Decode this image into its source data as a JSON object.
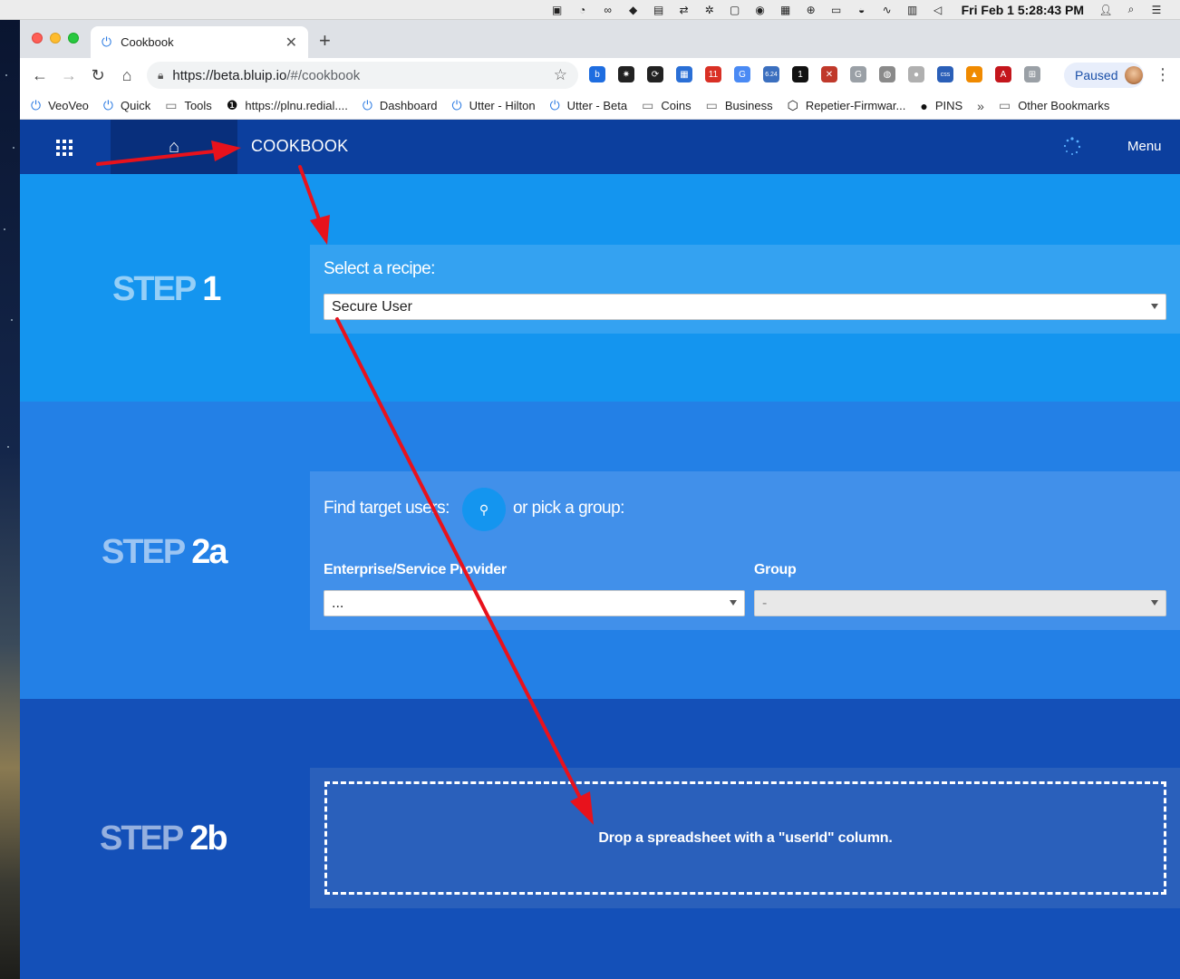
{
  "menubar": {
    "clock": "Fri Feb 1  5:28:43 PM",
    "tray_icons": [
      "cc-icon",
      "timer-icon",
      "creative-cloud-icon",
      "dropbox-icon",
      "docker-icon",
      "teamviewer-icon",
      "octopus-icon",
      "screen-icon",
      "nvidia-icon",
      "grid-icon",
      "lifebuoy-icon",
      "display-icon",
      "vpn-icon",
      "activity-icon",
      "memory-icon",
      "volume-icon"
    ]
  },
  "browser": {
    "tab_title": "Cookbook",
    "tab_close": "✕",
    "new_tab": "+",
    "url_host": "https://beta.bluip.io",
    "url_path": "/#/cookbook",
    "profile_label": "Paused",
    "extensions": [
      {
        "name": "bitly-icon",
        "label": "b",
        "color": "#1e6de0"
      },
      {
        "name": "gear-ext-icon",
        "label": "✷",
        "color": "#222222"
      },
      {
        "name": "sync-icon",
        "label": "⟳",
        "color": "#222222"
      },
      {
        "name": "calendar-grid-icon",
        "label": "▦",
        "color": "#2a6fd6"
      },
      {
        "name": "calendar-badge-icon",
        "label": "11",
        "color": "#d93025"
      },
      {
        "name": "translate-icon",
        "label": "G",
        "color": "#4a8af4"
      },
      {
        "name": "speed-icon",
        "label": "6.24",
        "color": "#3b6fbf"
      },
      {
        "name": "onepassword-icon",
        "label": "1",
        "color": "#111111"
      },
      {
        "name": "adblock-icon",
        "label": "✕",
        "color": "#c0392b"
      },
      {
        "name": "grammarly-icon",
        "label": "G",
        "color": "#9aa0a6"
      },
      {
        "name": "globe-ext-icon",
        "label": "◍",
        "color": "#8a8a8a"
      },
      {
        "name": "circle-ext-icon",
        "label": "●",
        "color": "#b0b0b0"
      },
      {
        "name": "css-icon",
        "label": "css",
        "color": "#2a5fb8"
      },
      {
        "name": "vlc-icon",
        "label": "▲",
        "color": "#f08a00"
      },
      {
        "name": "pdf-icon",
        "label": "A",
        "color": "#c4161c"
      },
      {
        "name": "apps-ext-icon",
        "label": "⊞",
        "color": "#9aa0a6"
      }
    ]
  },
  "bookmarks": [
    {
      "label": "VeoVeo",
      "icon": "power-icon"
    },
    {
      "label": "Quick",
      "icon": "power-icon"
    },
    {
      "label": "Tools",
      "icon": "folder-icon"
    },
    {
      "label": "https://plnu.redial....",
      "icon": "onepassword-icon"
    },
    {
      "label": "Dashboard",
      "icon": "power-icon"
    },
    {
      "label": "Utter - Hilton",
      "icon": "power-icon"
    },
    {
      "label": "Utter - Beta",
      "icon": "power-icon"
    },
    {
      "label": "Coins",
      "icon": "folder-icon"
    },
    {
      "label": "Business",
      "icon": "folder-icon"
    },
    {
      "label": "Repetier-Firmwar...",
      "icon": "cube-icon"
    },
    {
      "label": "PINS",
      "icon": "github-icon"
    }
  ],
  "bookmarks_overflow": "»",
  "other_bookmarks": "Other Bookmarks",
  "app": {
    "title": "COOKBOOK",
    "menu_label": "Menu"
  },
  "step1": {
    "word": "STEP",
    "num": "1",
    "heading": "Select a recipe:",
    "recipe_value": "Secure User"
  },
  "step2a": {
    "word": "STEP",
    "num": "2a",
    "find_label": "Find target users:",
    "pick_label": "or pick a group:",
    "enterprise_label": "Enterprise/Service Provider",
    "enterprise_value": "...",
    "group_label": "Group",
    "group_value": "-"
  },
  "step2b": {
    "word": "STEP",
    "num": "2b",
    "drop_text": "Drop a spreadsheet with a \"userId\" column."
  },
  "colors": {
    "header": "#0c3f9e",
    "home_block": "#082f7c",
    "step1_bg": "#1495ef",
    "step2a_bg": "#2380e6",
    "step2b_bg": "#1450b8",
    "annotation_arrow": "#e8121c"
  }
}
